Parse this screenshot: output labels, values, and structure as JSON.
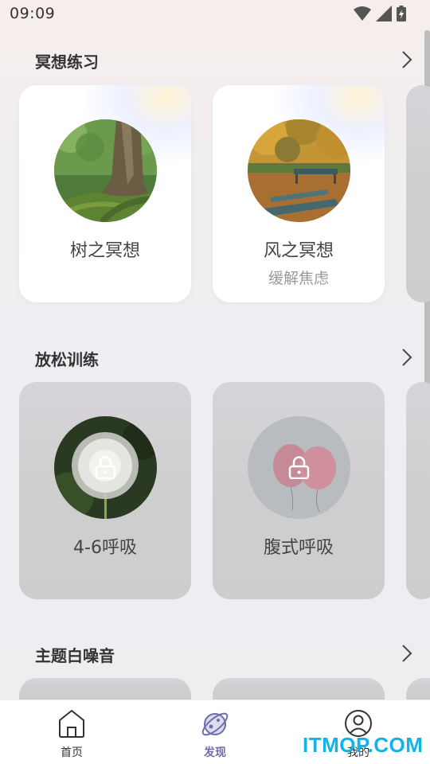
{
  "status_bar": {
    "time": "09:09"
  },
  "sections": [
    {
      "title": "冥想练习"
    },
    {
      "title": "放松训练"
    },
    {
      "title": "主题白噪音"
    }
  ],
  "meditation": {
    "cards": [
      {
        "title": "树之冥想",
        "subtitle": "",
        "image": "mossy-tree-trunk"
      },
      {
        "title": "风之冥想",
        "subtitle": "缓解焦虑",
        "image": "autumn-park-bench"
      }
    ]
  },
  "relaxation": {
    "cards": [
      {
        "title": "4-6呼吸",
        "image": "dandelion",
        "locked": true
      },
      {
        "title": "腹式呼吸",
        "image": "pink-balloons",
        "locked": true
      }
    ]
  },
  "tabbar": {
    "items": [
      {
        "label": "首页",
        "icon": "home-icon"
      },
      {
        "label": "发现",
        "icon": "planet-icon",
        "active": true
      },
      {
        "label": "我的",
        "icon": "person-icon"
      }
    ]
  },
  "watermark": "ITMOP.COM",
  "colors": {
    "accent": "#6e6fa8",
    "watermark": "#11b3e9"
  }
}
